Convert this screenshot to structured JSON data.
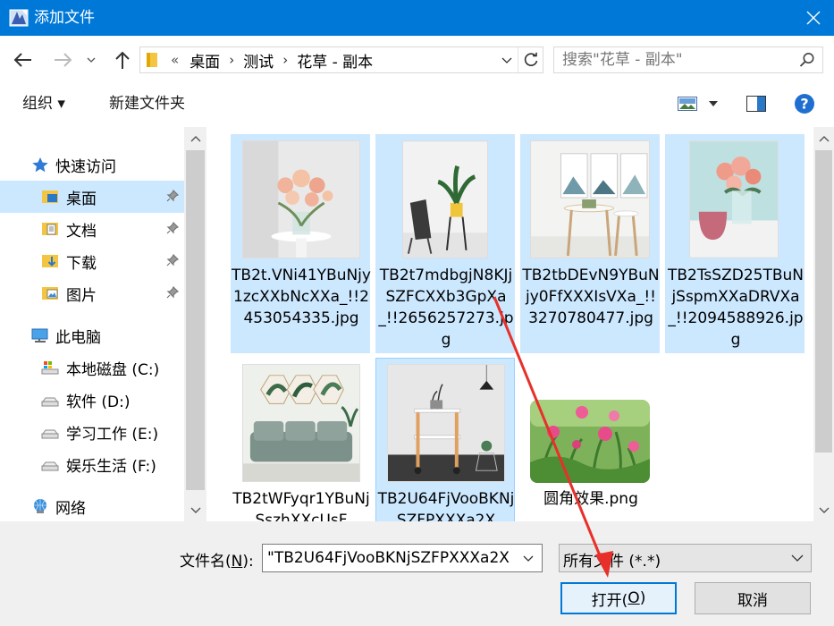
{
  "window": {
    "title": "添加文件",
    "close_label": "✕"
  },
  "address": {
    "lead": "«",
    "crumbs": [
      "桌面",
      "测试",
      "花草 - 副本"
    ],
    "sep": "›"
  },
  "search": {
    "placeholder": "搜索\"花草 - 副本\""
  },
  "toolbar": {
    "organize": "组织 ▾",
    "new_folder": "新建文件夹"
  },
  "sidebar": {
    "items": [
      {
        "label": "快速访问"
      },
      {
        "label": "桌面"
      },
      {
        "label": "文档"
      },
      {
        "label": "下载"
      },
      {
        "label": "图片"
      },
      {
        "label": "此电脑"
      },
      {
        "label": "本地磁盘 (C:)"
      },
      {
        "label": "软件 (D:)"
      },
      {
        "label": "学习工作 (E:)"
      },
      {
        "label": "娱乐生活 (F:)"
      },
      {
        "label": "网络"
      }
    ]
  },
  "files": [
    {
      "name": "TB2t.VNi41YBuNjy1zcXXbNcXXa_!!2453054335.jpg"
    },
    {
      "name": "TB2t7mdbgjN8KJjSZFCXXb3GpXa_!!2656257273.jpg"
    },
    {
      "name": "TB2tbDEvN9YBuNjy0FfXXXIsVXa_!!3270780477.jpg"
    },
    {
      "name": "TB2TsSZD25TBuNjSspmXXaDRVXa_!!2094588926.jpg"
    },
    {
      "name": "TB2tWFyqr1YBuNjSszhXXcUsF"
    },
    {
      "name": "TB2U64FjVooBKNjSZFPXXXa2X"
    },
    {
      "name": "圆角效果.png"
    }
  ],
  "bottom": {
    "filename_label": "文件名(",
    "filename_key": "N",
    "filename_label_end": "):",
    "filename_value": "\"TB2U64FjVooBKNjSZFPXXXa2X",
    "filetype_value": "所有文件 (*.*)",
    "open_pre": "打开(",
    "open_key": "O",
    "open_post": ")",
    "cancel": "取消"
  },
  "colors": {
    "titlebar": "#0078d7",
    "selection": "#cce8ff",
    "annotation_arrow": "#e8302a"
  }
}
